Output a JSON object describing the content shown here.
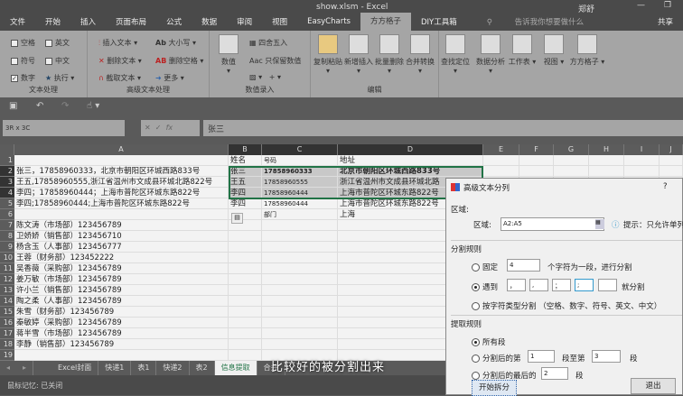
{
  "window": {
    "title": "show.xlsm - Excel",
    "user": "郑舒",
    "share": "共享"
  },
  "ribbon_tabs": [
    "文件",
    "开始",
    "插入",
    "页面布局",
    "公式",
    "数据",
    "审阅",
    "视图",
    "EasyCharts",
    "方方格子",
    "DIY工具箱"
  ],
  "active_tab": "方方格子",
  "tell_me": "告诉我你想要做什么",
  "groups": {
    "text": {
      "label": "文本处理",
      "items": [
        "空格",
        "英文",
        "符号",
        "中文",
        "数字",
        "执行"
      ]
    },
    "adv_text": {
      "label": "高级文本处理",
      "items": [
        "插入文本",
        "大小写",
        "删除文本",
        "删除空格",
        "截取文本",
        "更多"
      ]
    },
    "num": {
      "label": "数值录入",
      "items": [
        "数值",
        "四舍五入",
        "只保留数值"
      ]
    },
    "edit": {
      "label": "编辑",
      "items": [
        "复制粘贴",
        "新增插入",
        "批量删除",
        "合并转换",
        "查找定位"
      ]
    },
    "extra": [
      "数据分析",
      "工作表",
      "视图",
      "方方格子"
    ]
  },
  "formula_bar": {
    "name_box": "3R x 3C",
    "value": "张三"
  },
  "columns": [
    "A",
    "B",
    "C",
    "D",
    "E",
    "F",
    "G",
    "H",
    "I",
    "J"
  ],
  "rows": [
    {
      "n": "1",
      "a": "",
      "b": "姓名",
      "c": "号码",
      "d": "地址"
    },
    {
      "n": "2",
      "a": "张三，17858960333，北京市朝阳区环城西路833号",
      "b": "张三",
      "c": "17858960333",
      "d": "北京市朝阳区环城西路833号"
    },
    {
      "n": "3",
      "a": "王五,17858960555,浙江省温州市文成县环城北路822号",
      "b": "王五",
      "c": "17858960555",
      "d": "浙江省温州市文成县环城北路"
    },
    {
      "n": "4",
      "a": "李四；17858960444；上海市普陀区环城东路822号",
      "b": "李四",
      "c": "17858960444",
      "d": "上海市普陀区环城东路822号"
    },
    {
      "n": "5",
      "a": "李四;17858960444;上海市普陀区环城东路822号",
      "b": "李四",
      "c": "17858960444",
      "d": "上海市普陀区环城东路822号"
    },
    {
      "n": "6",
      "a": "",
      "b": "",
      "c": "部门",
      "d": "上海"
    },
    {
      "n": "7",
      "a": "陈文涛（市场部）123456789"
    },
    {
      "n": "8",
      "a": "卫娇娇（销售部）123456710"
    },
    {
      "n": "9",
      "a": "杨含玉（人事部）123456777"
    },
    {
      "n": "10",
      "a": "王蓉（财务部）123452222"
    },
    {
      "n": "11",
      "a": "吴香薇（采购部）123456789"
    },
    {
      "n": "12",
      "a": "姜万敏（市场部）123456789"
    },
    {
      "n": "13",
      "a": "许小兰（销售部）123456789"
    },
    {
      "n": "14",
      "a": "陶之柔（人事部）123456789"
    },
    {
      "n": "15",
      "a": "朱雪（财务部）123456789"
    },
    {
      "n": "16",
      "a": "秦敏婷（采购部）123456789"
    },
    {
      "n": "17",
      "a": "蒋半雪（市场部）123456789"
    },
    {
      "n": "18",
      "a": "李静（销售部）123456789"
    },
    {
      "n": "19",
      "a": ""
    }
  ],
  "sheet_tabs": [
    "Excel封面",
    "快递1",
    "表1",
    "快递2",
    "表2",
    "信息提取",
    "合并"
  ],
  "active_sheet": "信息提取",
  "status": "鼠标记忆: 已关闭",
  "dialog": {
    "title": "高级文本分列",
    "help": "?",
    "area_section": "区域:",
    "area_label": "区域:",
    "area_value": "A2:A5",
    "hint": "提示：只允许单列",
    "split_section": "分割规则",
    "fixed_label": "固定",
    "fixed_value": "4",
    "fixed_suffix": "个字符为一段，进行分割",
    "meet_label": "遇到",
    "delims": [
      "，",
      ",",
      "；",
      ";",
      ""
    ],
    "meet_suffix": "就分割",
    "type_label": "按字符类型分割 （空格、数字、符号、英文、中文）",
    "extract_section": "提取规则",
    "all_label": "所有段",
    "range_label": "分割后的第",
    "range_from": "1",
    "range_mid": "段至第",
    "range_to": "3",
    "range_suffix": "段",
    "last_label": "分割后的最后的",
    "last_value": "2",
    "last_suffix": "段",
    "start_button": "开始拆分",
    "exit_button": "退出"
  },
  "subtitle": "比较好的被分割出来"
}
